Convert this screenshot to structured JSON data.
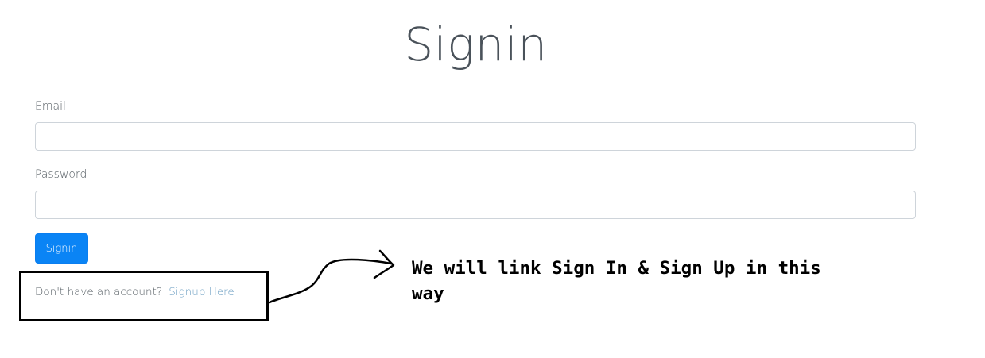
{
  "form": {
    "title": "Signin",
    "email_label": "Email",
    "email_value": "",
    "password_label": "Password",
    "password_value": "",
    "submit_label": "Signin",
    "signup_prompt": "Don't have an account?",
    "signup_link": "Signup Here"
  },
  "annotation": {
    "text": "We will link Sign In & Sign Up in this way",
    "color": "#000000"
  },
  "colors": {
    "primary_button": "#0a84f5",
    "link": "#6b9ec2",
    "title": "#4a525a"
  },
  "icons": {
    "arrow": "hand-drawn-arrow-icon"
  }
}
